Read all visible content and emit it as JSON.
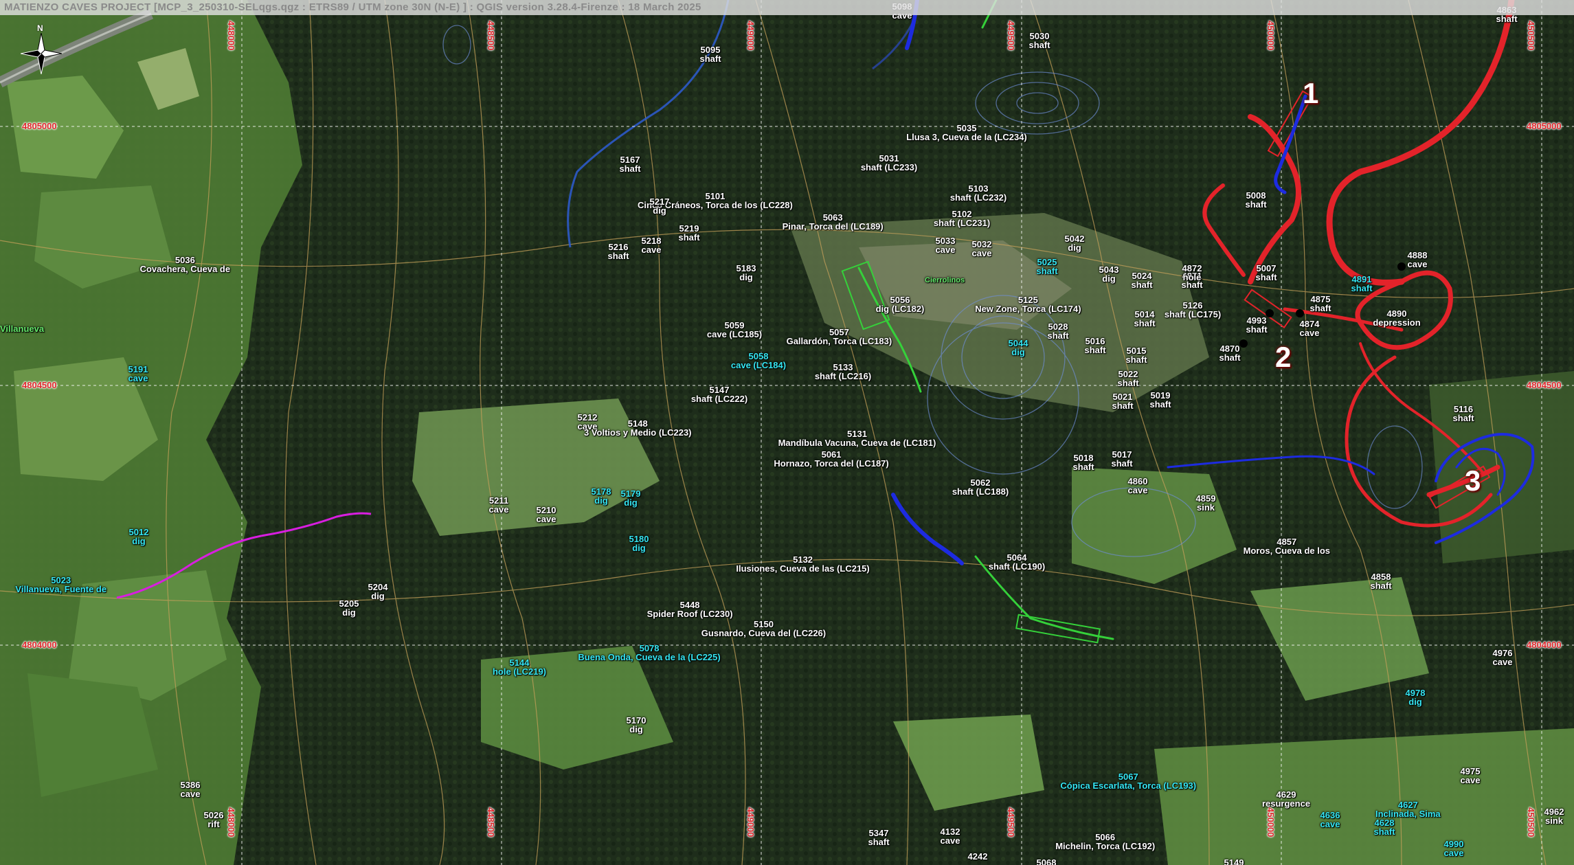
{
  "title_bar": {
    "text": "MATIENZO CAVES PROJECT [MCP_3_250310-SELqgs.qgz : ETRS89 / UTM zone 30N (N-E) ] : QGIS version 3.28.4-Firenze :  18 March 2025"
  },
  "north_arrow": {
    "label": "N",
    "icon": "north-arrow-icon"
  },
  "grid_labels": {
    "eastings": [
      "448000",
      "448500",
      "449000",
      "449500",
      "450000",
      "450500"
    ],
    "northings": [
      "4805000",
      "4804500",
      "4804000"
    ]
  },
  "site_labels": [
    {
      "id": "5098",
      "type": "cave",
      "style": "white"
    },
    {
      "id": "5030",
      "type": "shaft",
      "style": "white"
    },
    {
      "id": "4863",
      "type": "shaft",
      "style": "white"
    },
    {
      "id": "5095",
      "type": "shaft",
      "style": "white"
    },
    {
      "id": "5035",
      "type": "Llusa 3, Cueva de la (LC234)",
      "style": "white"
    },
    {
      "id": "5031",
      "type": "shaft (LC233)",
      "style": "white"
    },
    {
      "id": "5167",
      "type": "shaft",
      "style": "white"
    },
    {
      "id": "5101",
      "type": "Cinco Cráneos, Torca de los (LC228)",
      "style": "white"
    },
    {
      "id": "5103",
      "type": "shaft (LC232)",
      "style": "white"
    },
    {
      "id": "5008",
      "type": "shaft",
      "style": "white"
    },
    {
      "id": "5217",
      "type": "dig",
      "style": "white"
    },
    {
      "id": "5219",
      "type": "shaft",
      "style": "white"
    },
    {
      "id": "5063",
      "type": "Pinar, Torca del (LC189)",
      "style": "white"
    },
    {
      "id": "5102",
      "type": "shaft (LC231)",
      "style": "white"
    },
    {
      "id": "5218",
      "type": "cave",
      "style": "white"
    },
    {
      "id": "5216",
      "type": "shaft",
      "style": "white"
    },
    {
      "id": "5033",
      "type": "cave",
      "style": "white"
    },
    {
      "id": "5032",
      "type": "cave",
      "style": "white"
    },
    {
      "id": "5042",
      "type": "dig",
      "style": "white"
    },
    {
      "id": "5036",
      "type": "Covachera, Cueva de",
      "style": "white"
    },
    {
      "id": "5183",
      "type": "dig",
      "style": "white"
    },
    {
      "id": "5025",
      "type": "shaft",
      "style": "cyan"
    },
    {
      "id": "5043",
      "type": "dig",
      "style": "white"
    },
    {
      "id": "5024",
      "type": "shaft",
      "style": "white"
    },
    {
      "id": "4871",
      "type": "shaft",
      "style": "white"
    },
    {
      "id": "4872",
      "type": "hole",
      "style": "white"
    },
    {
      "id": "5007",
      "type": "shaft",
      "style": "white"
    },
    {
      "id": "4888",
      "type": "cave",
      "style": "white"
    },
    {
      "id": "4891",
      "type": "shaft",
      "style": "cyan"
    },
    {
      "id": "5056",
      "type": "dig (LC182)",
      "style": "white"
    },
    {
      "id": "5125",
      "type": "New Zone, Torca (LC174)",
      "style": "white"
    },
    {
      "id": "5014",
      "type": "shaft",
      "style": "white"
    },
    {
      "id": "5126",
      "type": "shaft (LC175)",
      "style": "white"
    },
    {
      "id": "4875",
      "type": "shaft",
      "style": "white"
    },
    {
      "id": "4890",
      "type": "depression",
      "style": "white"
    },
    {
      "id": "5059",
      "type": "cave (LC185)",
      "style": "white"
    },
    {
      "id": "5057",
      "type": "Gallardón, Torca (LC183)",
      "style": "white"
    },
    {
      "id": "5028",
      "type": "shaft",
      "style": "white"
    },
    {
      "id": "4993",
      "type": "shaft",
      "style": "white"
    },
    {
      "id": "4874",
      "type": "cave",
      "style": "white"
    },
    {
      "id": "5016",
      "type": "shaft",
      "style": "white"
    },
    {
      "id": "5044",
      "type": "dig",
      "style": "cyan"
    },
    {
      "id": "4870",
      "type": "shaft",
      "style": "white"
    },
    {
      "id": "5015",
      "type": "shaft",
      "style": "white"
    },
    {
      "id": "5058",
      "type": "cave (LC184)",
      "style": "cyan"
    },
    {
      "id": "5133",
      "type": "shaft (LC216)",
      "style": "white"
    },
    {
      "id": "5191",
      "type": "cave",
      "style": "cyan"
    },
    {
      "id": "5022",
      "type": "shaft",
      "style": "white"
    },
    {
      "id": "5147",
      "type": "shaft (LC222)",
      "style": "white"
    },
    {
      "id": "5021",
      "type": "shaft",
      "style": "white"
    },
    {
      "id": "5019",
      "type": "shaft",
      "style": "white"
    },
    {
      "id": "5116",
      "type": "shaft",
      "style": "white"
    },
    {
      "id": "5212",
      "type": "cave",
      "style": "white"
    },
    {
      "id": "5148",
      "type": "3 Voltios y Medio (LC223)",
      "style": "white"
    },
    {
      "id": "5131",
      "type": "Mandíbula Vacuna, Cueva de (LC181)",
      "style": "white"
    },
    {
      "id": "5061",
      "type": "Hornazo, Torca del (LC187)",
      "style": "white"
    },
    {
      "id": "5018",
      "type": "shaft",
      "style": "white"
    },
    {
      "id": "5017",
      "type": "shaft",
      "style": "white"
    },
    {
      "id": "5062",
      "type": "shaft (LC188)",
      "style": "white"
    },
    {
      "id": "4860",
      "type": "cave",
      "style": "white"
    },
    {
      "id": "5178",
      "type": "dig",
      "style": "cyan"
    },
    {
      "id": "5179",
      "type": "dig",
      "style": "cyan"
    },
    {
      "id": "4859",
      "type": "sink",
      "style": "white"
    },
    {
      "id": "5211",
      "type": "cave",
      "style": "white"
    },
    {
      "id": "5210",
      "type": "cave",
      "style": "white"
    },
    {
      "id": "5012",
      "type": "dig",
      "style": "cyan"
    },
    {
      "id": "5180",
      "type": "dig",
      "style": "cyan"
    },
    {
      "id": "4857",
      "type": "Moros, Cueva de los",
      "style": "white"
    },
    {
      "id": "5132",
      "type": "Ilusiones, Cueva de las (LC215)",
      "style": "white"
    },
    {
      "id": "5064",
      "type": "shaft (LC190)",
      "style": "white"
    },
    {
      "id": "5023",
      "type": "Villanueva, Fuente de",
      "style": "cyan"
    },
    {
      "id": "4858",
      "type": "shaft",
      "style": "white"
    },
    {
      "id": "5204",
      "type": "dig",
      "style": "white"
    },
    {
      "id": "5205",
      "type": "dig",
      "style": "white"
    },
    {
      "id": "5448",
      "type": "Spider Roof (LC230)",
      "style": "white"
    },
    {
      "id": "5150",
      "type": "Gusnardo, Cueva del (LC226)",
      "style": "white"
    },
    {
      "id": "5078",
      "type": "Buena Onda, Cueva de la (LC225)",
      "style": "cyan"
    },
    {
      "id": "4976",
      "type": "cave",
      "style": "white"
    },
    {
      "id": "5144",
      "type": "hole (LC219)",
      "style": "cyan"
    },
    {
      "id": "4978",
      "type": "dig",
      "style": "cyan"
    },
    {
      "id": "5170",
      "type": "dig",
      "style": "white"
    },
    {
      "id": "5067",
      "type": "Cópica Escarlata, Torca (LC193)",
      "style": "cyan"
    },
    {
      "id": "4975",
      "type": "cave",
      "style": "white"
    },
    {
      "id": "4629",
      "type": "resurgence",
      "style": "white"
    },
    {
      "id": "4627",
      "type": "Inclinada, Sima",
      "style": "cyan"
    },
    {
      "id": "5386",
      "type": "cave",
      "style": "white"
    },
    {
      "id": "4636",
      "type": "cave",
      "style": "cyan"
    },
    {
      "id": "4628",
      "type": "shaft",
      "style": "cyan"
    },
    {
      "id": "4962",
      "type": "sink",
      "style": "white"
    },
    {
      "id": "5026",
      "type": "rift",
      "style": "white"
    },
    {
      "id": "5347",
      "type": "shaft",
      "style": "white"
    },
    {
      "id": "4132",
      "type": "cave",
      "style": "white"
    },
    {
      "id": "5066",
      "type": "Michelin, Torca (LC192)",
      "style": "white"
    },
    {
      "id": "4990",
      "type": "cave",
      "style": "cyan"
    },
    {
      "id": "4242",
      "type": "",
      "style": "white"
    },
    {
      "id": "5149",
      "type": "",
      "style": "white"
    },
    {
      "id": "5068",
      "type": "",
      "style": "white"
    }
  ],
  "place_labels": [
    {
      "text": "Villanueva",
      "style": "green"
    },
    {
      "text": "Cierrolinos",
      "style": "green"
    }
  ],
  "highlight_numbers": [
    "1",
    "2",
    "3"
  ],
  "survey_colors": {
    "red": "#e3232a",
    "blue": "#1d2be0",
    "green": "#35d13a",
    "magenta": "#d81ee0",
    "contour": "#c6a05a",
    "grid": "#ffffff",
    "label_cyan": "#35e6f2",
    "coord_red": "#e1282d"
  }
}
